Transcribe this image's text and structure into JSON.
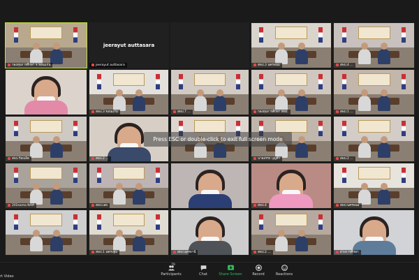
{
  "meeting": {
    "fullscreen_hint": "Press ESC or double-click to exit full screen mode"
  },
  "tiles": [
    {
      "label": "กองทุนการศึกษา จ.ขอนแก่น",
      "type": "room",
      "wall": "#b8a98e",
      "active": true
    },
    {
      "label": "jeerayut auttasara",
      "type": "name",
      "center": "jeerayut auttasara"
    },
    {
      "label": "",
      "type": "blank"
    },
    {
      "label": "สพป.3 นครพนม",
      "type": "room",
      "wall": "#d9d4cc"
    },
    {
      "label": "สพป.4 ...",
      "type": "room",
      "wall": "#c9c1bd"
    },
    {
      "label": "",
      "type": "face",
      "bg": "#dcd3cd",
      "shirt": "#e38aa9"
    },
    {
      "label": "สพป.3 ขอนแก่น",
      "type": "room",
      "wall": "#e4e0dc"
    },
    {
      "label": "สพป.7 ...",
      "type": "room",
      "wall": "#d2cbc4"
    },
    {
      "label": "กองทุนการศึกษา สพป.",
      "type": "room",
      "wall": "#cfc7c0"
    },
    {
      "label": "สพป.1 ...",
      "type": "room",
      "wall": "#c3b6aa"
    },
    {
      "label": "สพป.ร้อยเอ็ด",
      "type": "room",
      "wall": "#cfc9c3"
    },
    {
      "label": "สพป.2 ...",
      "type": "face",
      "bg": "#d7cfc6",
      "shirt": "#3a4a6a"
    },
    {
      "label": "",
      "type": "room",
      "wall": "#ded6ce"
    },
    {
      "label": "นายอรรถ บุญคำ",
      "type": "room",
      "wall": "#c0b6ab"
    },
    {
      "label": "สพป.2 ...",
      "type": "room",
      "wall": "#d3ccc7"
    },
    {
      "label": "202sama NHA",
      "type": "room",
      "wall": "#a9a39b"
    },
    {
      "label": "สพป.เลย",
      "type": "room",
      "wall": "#bfb4b4"
    },
    {
      "label": "",
      "type": "face",
      "bg": "#bdb6b5",
      "shirt": "#2b3f74"
    },
    {
      "label": "สพป.4",
      "type": "face",
      "bg": "#b98b84",
      "shirt": "#ee9ac0"
    },
    {
      "label": "สพป.นครพนม",
      "type": "room",
      "wall": "#e7e3dd"
    },
    {
      "label": "",
      "type": "room",
      "wall": "#cfcfcf"
    },
    {
      "label": "สพป.1 นครปฐม",
      "type": "room",
      "wall": "#e1dcd2"
    },
    {
      "label": "สพป.อุดรธานี",
      "type": "face",
      "bg": "#cdcdcd",
      "shirt": "#4f5358"
    },
    {
      "label": "สพป.2 ...",
      "type": "room",
      "wall": "#b7a9a0"
    },
    {
      "label": "ฝ่ายการศึกษา",
      "type": "face",
      "bg": "#d1d3d7",
      "shirt": "#5f7d9a"
    }
  ],
  "toolbar": {
    "video_label": "rt Video",
    "participants_label": "Participants",
    "participants_count": "79",
    "chat_label": "Chat",
    "share_label": "Share Screen",
    "record_label": "Record",
    "reactions_label": "Reactions"
  },
  "colors": {
    "active_border": "#c6e23c",
    "share_green": "#2fbf5b",
    "muted_red": "#e34b4b"
  }
}
